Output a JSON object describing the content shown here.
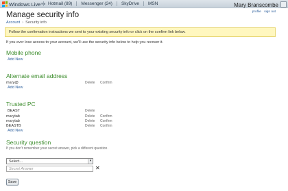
{
  "header": {
    "brand": "Windows Live™",
    "nav": [
      "Hotmail (89)",
      "Messenger (24)",
      "SkyDrive",
      "MSN"
    ],
    "user_name": "Mary Branscombe",
    "profile_link": "profile",
    "signout_link": "sign out"
  },
  "page": {
    "title": "Manage security info",
    "breadcrumb": [
      "Account",
      "Security info"
    ],
    "notice": "Follow the confirmation instructions we sent to your existing security info or click on the confirm link below.",
    "intro": "If you ever lose access to your account, we'll use the security info below to help you recover it."
  },
  "mobile_phone": {
    "title": "Mobile phone",
    "add_label": "Add New"
  },
  "alternate_email": {
    "title": "Alternate email address",
    "items": [
      {
        "value": "mary@",
        "delete": "Delete",
        "confirm": "Confirm"
      }
    ],
    "add_label": "Add New"
  },
  "trusted_pc": {
    "title": "Trusted PC",
    "items": [
      {
        "value": "BEAST",
        "delete": "Delete",
        "confirm": ""
      },
      {
        "value": "marytab",
        "delete": "Delete",
        "confirm": "Confirm"
      },
      {
        "value": "marytab",
        "delete": "Delete",
        "confirm": "Confirm"
      },
      {
        "value": "BEASTB",
        "delete": "Delete",
        "confirm": "Confirm"
      }
    ],
    "add_label": "Add New"
  },
  "security_question": {
    "title": "Security question",
    "hint": "If you don't remember your secret answer, pick a different question.",
    "select_value": "Select...",
    "answer_placeholder": "Secret Answer",
    "clear_symbol": "✕"
  },
  "save_label": "Save",
  "colors": {
    "section_title": "#3a8b2a",
    "link": "#2b5e9c",
    "notice_bg": "#fff7bf"
  }
}
